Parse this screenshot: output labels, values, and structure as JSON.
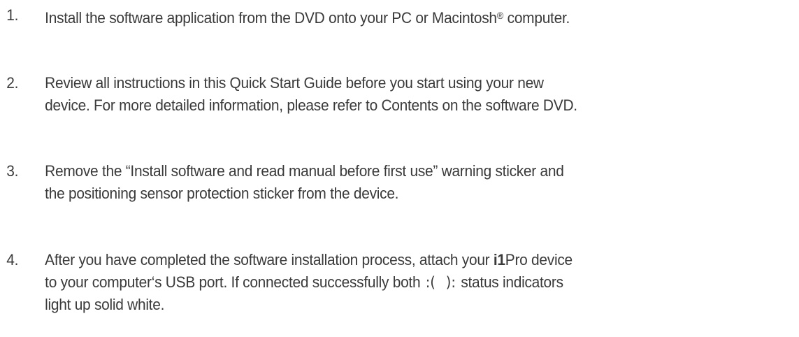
{
  "steps": [
    {
      "number": "1.",
      "lines": [
        "Install the software application from the DVD onto your PC or Macintosh",
        "®",
        " computer."
      ]
    },
    {
      "number": "2.",
      "lines": [
        "Review all instructions in this Quick Start Guide before you start using your new",
        "device. For more detailed information, please refer to Contents on the software DVD."
      ]
    },
    {
      "number": "3.",
      "lines": [
        "Remove the “Install software and read manual before first use” warning sticker and",
        "the positioning sensor protection sticker from the device."
      ]
    },
    {
      "number": "4.",
      "line1_before": "After you have completed the software installation process, attach your ",
      "brand_bold": "i1",
      "brand_regular": "Pro device",
      "line2_before": "to your computer‘s USB port. If connected successfully both ",
      "indicator_left": ":(",
      "indicator_right": "):",
      "line2_after": " status indicators",
      "line3": "light up solid white."
    }
  ]
}
